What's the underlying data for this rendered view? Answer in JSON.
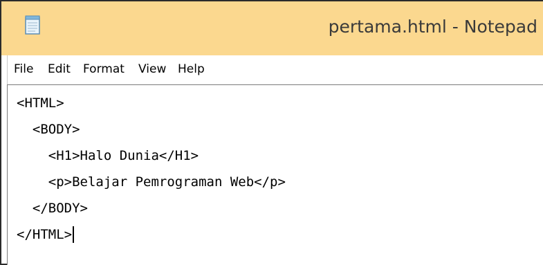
{
  "window": {
    "title": "pertama.html - Notepad",
    "app_icon": "notepad-icon"
  },
  "menu": {
    "items": [
      "File",
      "Edit",
      "Format",
      "View",
      "Help"
    ]
  },
  "editor": {
    "lines": [
      "<HTML>",
      "  <BODY>",
      "    <H1>Halo Dunia</H1>",
      "    <p>Belajar Pemrograman Web</p>",
      "  </BODY>",
      "</HTML>"
    ]
  },
  "colors": {
    "titlebar": "#fbd88f",
    "window_border": "#2b2b2b"
  }
}
